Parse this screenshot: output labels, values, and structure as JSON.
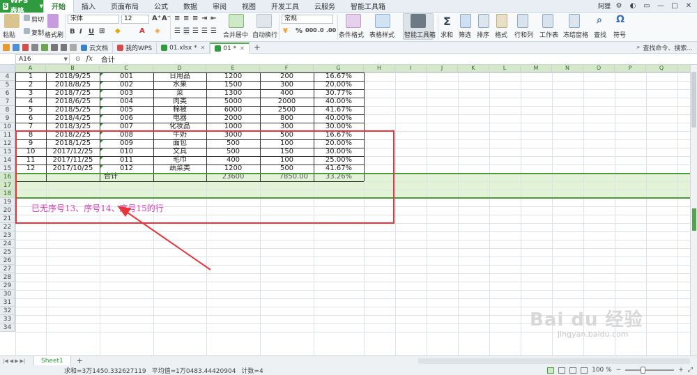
{
  "app": {
    "name": "WPS 表格"
  },
  "menu_tabs": [
    "开始",
    "插入",
    "页面布局",
    "公式",
    "数据",
    "审阅",
    "视图",
    "开发工具",
    "云服务",
    "智能工具箱"
  ],
  "user_name": "阿狸",
  "ribbon": {
    "paste": "粘贴",
    "cut": "剪切",
    "copy": "复制",
    "format_painter": "格式刷",
    "font_name": "宋体",
    "font_size": "12",
    "merge_center": "合并居中",
    "wrap_text": "自动换行",
    "number_format": "常规",
    "conditional_format": "条件格式",
    "table_style": "表格样式",
    "smart_toolbox": "智能工具箱",
    "sum": "求和",
    "filter": "筛选",
    "sort": "排序",
    "format": "格式",
    "row_col": "行和列",
    "worksheet": "工作表",
    "freeze": "冻结窗格",
    "find": "查找",
    "symbol": "符号"
  },
  "doc_tabs": [
    {
      "label": "云文档",
      "active": false
    },
    {
      "label": "我的WPS",
      "active": false
    },
    {
      "label": "01.xlsx *",
      "active": false
    },
    {
      "label": "01 *",
      "active": true
    }
  ],
  "search_command": "查找命令、搜索...",
  "formula_bar": {
    "cell_ref": "A16",
    "fx": "fx",
    "content": "合计"
  },
  "columns": [
    "A",
    "B",
    "C",
    "D",
    "E",
    "F",
    "G",
    "H",
    "I",
    "J",
    "K",
    "L",
    "M",
    "N",
    "O",
    "P",
    "Q",
    "R"
  ],
  "row_numbers": [
    "4",
    "5",
    "6",
    "7",
    "8",
    "9",
    "10",
    "11",
    "12",
    "13",
    "14",
    "15",
    "16",
    "17",
    "18",
    "19",
    "20",
    "21",
    "22",
    "23",
    "24",
    "25",
    "26",
    "27",
    "28",
    "29",
    "30",
    "31",
    "32",
    "33",
    "34"
  ],
  "rows": [
    {
      "a": "1",
      "b": "2018/9/25",
      "c": "001",
      "d": "日用品",
      "e": "1200",
      "f": "200",
      "g": "16.67%"
    },
    {
      "a": "2",
      "b": "2018/8/25",
      "c": "002",
      "d": "水果",
      "e": "1500",
      "f": "300",
      "g": "20.00%"
    },
    {
      "a": "3",
      "b": "2018/7/25",
      "c": "003",
      "d": "菜",
      "e": "1300",
      "f": "400",
      "g": "30.77%"
    },
    {
      "a": "4",
      "b": "2018/6/25",
      "c": "004",
      "d": "肉类",
      "e": "5000",
      "f": "2000",
      "g": "40.00%"
    },
    {
      "a": "5",
      "b": "2018/5/25",
      "c": "005",
      "d": "棉被",
      "e": "6000",
      "f": "2500",
      "g": "41.67%"
    },
    {
      "a": "6",
      "b": "2018/4/25",
      "c": "006",
      "d": "电器",
      "e": "2000",
      "f": "800",
      "g": "40.00%"
    },
    {
      "a": "7",
      "b": "2018/3/25",
      "c": "007",
      "d": "化妆品",
      "e": "1000",
      "f": "300",
      "g": "30.00%"
    },
    {
      "a": "8",
      "b": "2018/2/25",
      "c": "008",
      "d": "牛奶",
      "e": "3000",
      "f": "500",
      "g": "16.67%"
    },
    {
      "a": "9",
      "b": "2018/1/25",
      "c": "009",
      "d": "面包",
      "e": "500",
      "f": "100",
      "g": "20.00%"
    },
    {
      "a": "10",
      "b": "2017/12/25",
      "c": "010",
      "d": "文具",
      "e": "500",
      "f": "150",
      "g": "30.00%"
    },
    {
      "a": "11",
      "b": "2017/11/25",
      "c": "011",
      "d": "毛巾",
      "e": "400",
      "f": "100",
      "g": "25.00%"
    },
    {
      "a": "12",
      "b": "2017/10/25",
      "c": "012",
      "d": "蔬菜类",
      "e": "1200",
      "f": "500",
      "g": "41.67%"
    }
  ],
  "total_row": {
    "label": "合计",
    "e": "23600",
    "f": "7850.00",
    "g": "33.26%"
  },
  "annotation": {
    "text": "已无序号13、序号14、序号15的行",
    "color": "#d93fb8",
    "box_color": "#e8353b"
  },
  "sheet_tabs": [
    "Sheet1"
  ],
  "status": {
    "sum": "求和=3万1450.332627119",
    "average": "平均值=1万0483.44420904",
    "count": "计数=4",
    "zoom": "100 %"
  },
  "watermark": {
    "main": "Bai du 经验",
    "sub": "jingyan.baidu.com"
  },
  "colors": {
    "accent": "#2f9a3e",
    "selection": "#e2f3d8",
    "selection_border": "#4a9a3c"
  }
}
